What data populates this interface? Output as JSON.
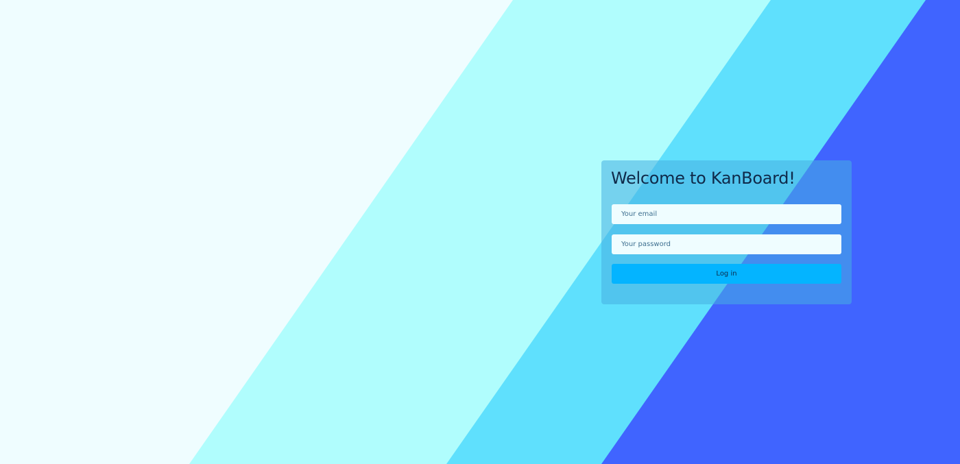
{
  "background": {
    "colors": {
      "base": "#effdff",
      "band_light": "#b0fdfd",
      "band_mid": "#5fe0fd",
      "band_dark": "#4064ff"
    }
  },
  "login": {
    "title": "Welcome to KanBoard!",
    "email_placeholder": "Your email",
    "email_value": "",
    "password_placeholder": "Your password",
    "password_value": "",
    "submit_label": "Log in",
    "accent_color": "#04b4ff"
  }
}
